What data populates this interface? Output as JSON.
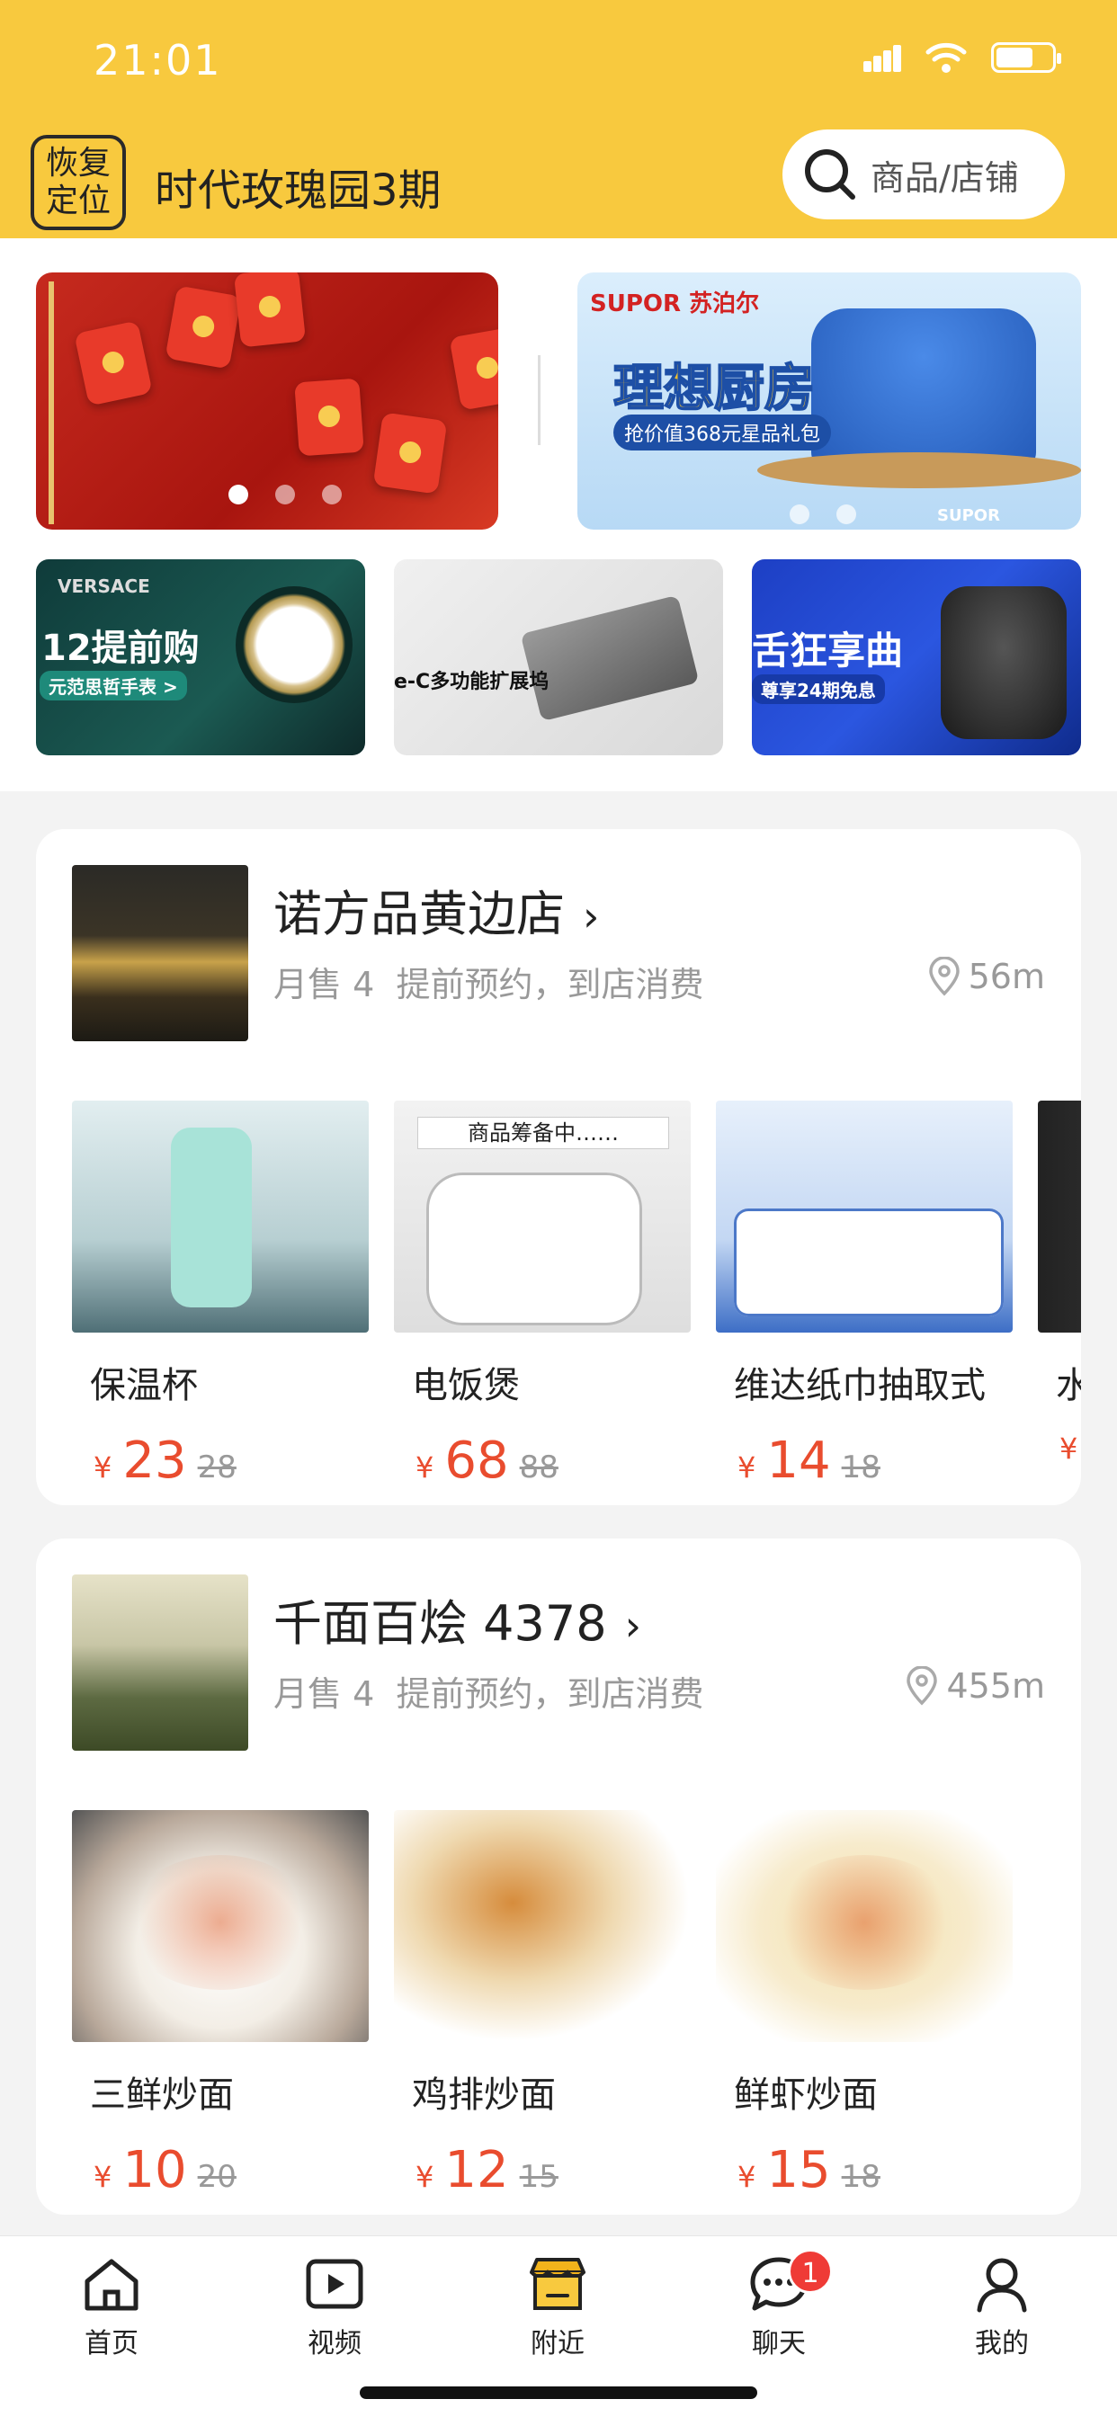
{
  "status_bar": {
    "time": "21:01"
  },
  "header": {
    "restore_button": "恢复定位",
    "location": "时代玫瑰园3期",
    "search_placeholder": "商品/店铺"
  },
  "banners": {
    "left": {
      "icon": "red-packet-banner"
    },
    "right": {
      "brand": "SUPOR 苏泊尔",
      "title": "理想厨房",
      "subtitle": "抢价值368元星品礼包",
      "footer": "SUPOR"
    },
    "promos": [
      {
        "brand": "VERSACE",
        "title": "12提前购",
        "subtitle": "元范思哲手表 >"
      },
      {
        "title": "e-C多功能扩展坞"
      },
      {
        "title": "舌狂享曲",
        "subtitle": "尊享24期免息"
      }
    ]
  },
  "stores": [
    {
      "name": "诺方品黄边店",
      "monthly_sales": "月售 4",
      "service": "提前预约，到店消费",
      "distance": "56m",
      "products": [
        {
          "name": "保温杯",
          "price": "23",
          "old_price": "28",
          "img": "bottle"
        },
        {
          "name": "电饭煲",
          "price": "68",
          "old_price": "88",
          "img": "cooker",
          "tag": "商品筹备中……"
        },
        {
          "name": "维达纸巾抽取式",
          "price": "14",
          "old_price": "18",
          "img": "tissue"
        },
        {
          "name": "水",
          "price": "",
          "old_price": "",
          "img": "edge"
        }
      ]
    },
    {
      "name": "千面百烩 4378",
      "monthly_sales": "月售 4",
      "service": "提前预约，到店消费",
      "distance": "455m",
      "products": [
        {
          "name": "三鲜炒面",
          "price": "10",
          "old_price": "20",
          "img": "seafood"
        },
        {
          "name": "鸡排炒面",
          "price": "12",
          "old_price": "15",
          "img": "chicken"
        },
        {
          "name": "鲜虾炒面",
          "price": "15",
          "old_price": "18",
          "img": "shrimp"
        }
      ]
    }
  ],
  "currency_symbol": "¥",
  "tabbar": {
    "items": [
      {
        "label": "首页",
        "icon": "home-icon"
      },
      {
        "label": "视频",
        "icon": "video-icon"
      },
      {
        "label": "附近",
        "icon": "store-icon"
      },
      {
        "label": "聊天",
        "icon": "chat-icon",
        "badge": "1"
      },
      {
        "label": "我的",
        "icon": "profile-icon"
      }
    ]
  },
  "colors": {
    "brand_yellow": "#f8c93e",
    "price_red": "#e94c2e",
    "badge_red": "#ef3b36"
  }
}
